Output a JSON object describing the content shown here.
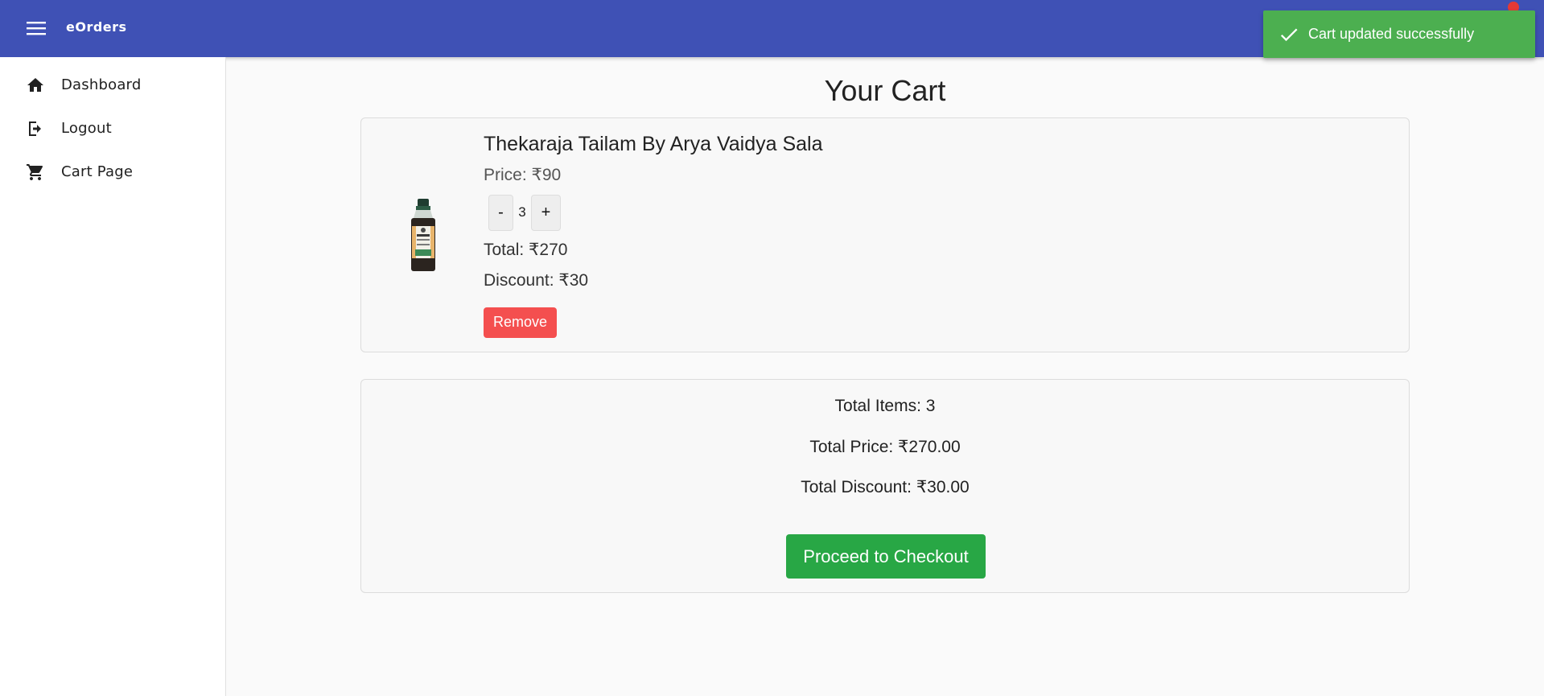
{
  "app": {
    "title": "eOrders"
  },
  "sidebar": {
    "items": [
      {
        "label": "Dashboard",
        "icon": "home-icon"
      },
      {
        "label": "Logout",
        "icon": "logout-icon"
      },
      {
        "label": "Cart Page",
        "icon": "cart-icon"
      }
    ]
  },
  "page": {
    "title": "Your Cart"
  },
  "cart_item": {
    "name": "Thekaraja Tailam By Arya Vaidya Sala",
    "price": "Price: ₹90",
    "quantity": "3",
    "minus_label": "-",
    "plus_label": "+",
    "total": "Total: ₹270",
    "discount": "Discount: ₹30",
    "remove_label": "Remove"
  },
  "summary": {
    "total_items": "Total Items: 3",
    "total_price": "Total Price: ₹270.00",
    "total_discount": "Total Discount: ₹30.00",
    "checkout_label": "Proceed to Checkout"
  },
  "toast": {
    "message": "Cart updated successfully",
    "icon": "check-icon"
  },
  "colors": {
    "header": "#3f51b5",
    "toast": "#4caf50",
    "remove": "#f44f4f",
    "checkout": "#28a745",
    "notification": "#e53935"
  }
}
